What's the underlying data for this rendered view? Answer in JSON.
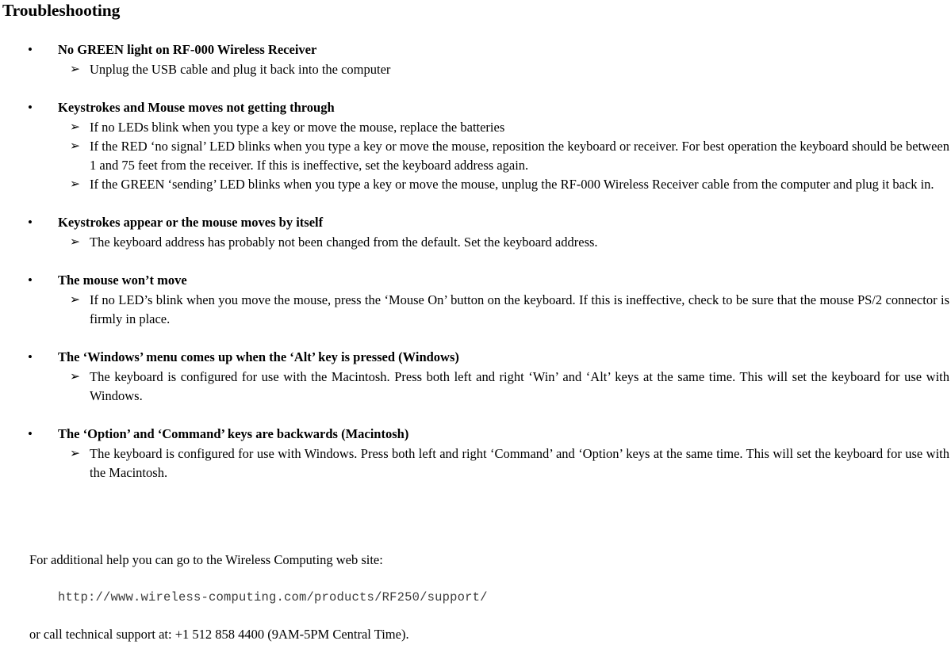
{
  "document": {
    "title": "Troubleshooting",
    "bullet_glyph": "•",
    "arrow_glyph": "➢"
  },
  "sections": [
    {
      "heading": "No GREEN light on RF-000 Wireless Receiver",
      "items": [
        "Unplug the USB cable and plug it back into the computer"
      ]
    },
    {
      "heading": "Keystrokes and Mouse moves not getting through",
      "items": [
        "If no LEDs blink when you type a key or move the mouse, replace the batteries",
        "If the RED ‘no signal’ LED blinks when you type a key or move the mouse, reposition the keyboard or receiver. For best operation the keyboard should be between 1 and 75 feet from the receiver. If this is ineffective, set the keyboard address again.",
        "If the GREEN ‘sending’ LED blinks when you type a key or move the mouse, unplug the RF-000 Wireless Receiver cable from the computer and plug it back in."
      ]
    },
    {
      "heading": "Keystrokes appear or the mouse moves by itself",
      "items": [
        " The keyboard address has probably not been changed from the default. Set the keyboard address."
      ]
    },
    {
      "heading": "The mouse won’t move",
      "items": [
        "If no LED’s blink when you move the mouse, press the ‘Mouse On’ button on the keyboard. If this is ineffective, check to be sure that the mouse PS/2 connector is firmly in place."
      ]
    },
    {
      "heading": "The ‘Windows’ menu comes up when the ‘Alt’ key is pressed (Windows)",
      "items": [
        "The keyboard is configured for use with the Macintosh. Press both left and right ‘Win’ and ‘Alt’ keys at the same time. This will set the keyboard for use with Windows."
      ]
    },
    {
      "heading": "The ‘Option’ and  ‘Command’ keys are backwards (Macintosh)",
      "items": [
        "The keyboard is configured for use with Windows. Press both left and right ‘Command’ and ‘Option’ keys at the same time. This will set the keyboard for use with the Macintosh."
      ]
    }
  ],
  "footer": {
    "intro": "For additional help you can go to the Wireless Computing web site:",
    "url": "http://www.wireless-computing.com/products/RF250/support/",
    "phone_line": "or call technical support at: +1 512 858 4400 (9AM-5PM Central Time)."
  }
}
